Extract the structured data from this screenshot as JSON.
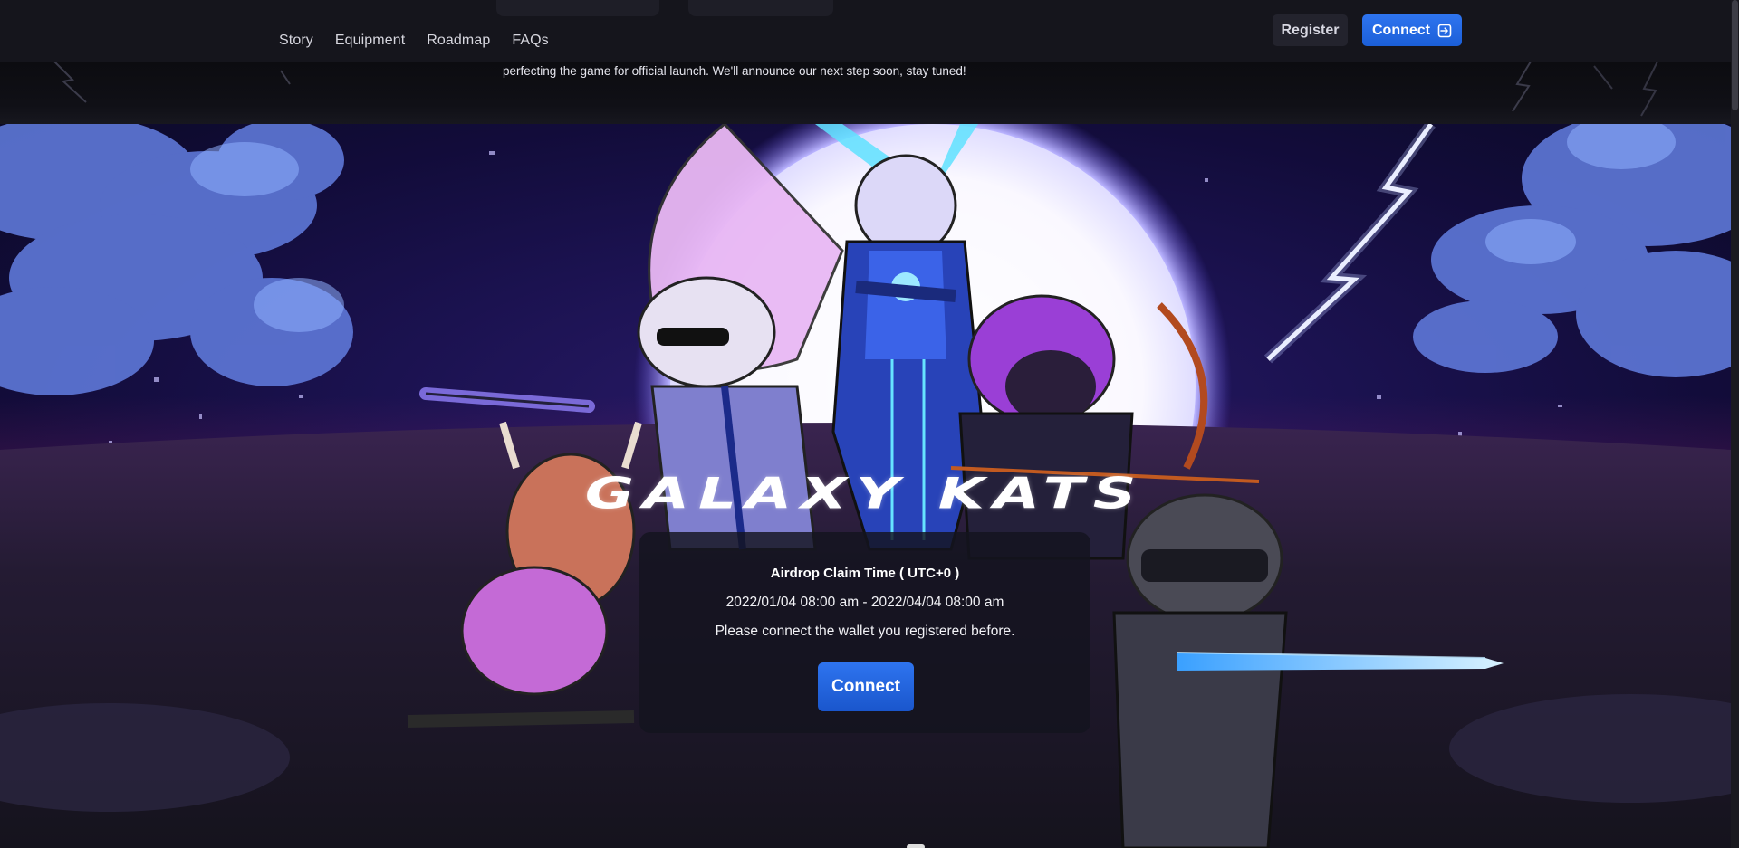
{
  "nav": {
    "links": [
      "Story",
      "Equipment",
      "Roadmap",
      "FAQs"
    ],
    "register_label": "Register",
    "connect_label": "Connect",
    "connect_icon": "login-arrow-icon"
  },
  "announcement": {
    "text": "perfecting the game for official launch. We'll announce our next step soon, stay tuned!"
  },
  "hero": {
    "logo_text": "GALAXY KATS"
  },
  "claim": {
    "title": "Airdrop Claim Time ( UTC+0 )",
    "range": "2022/01/04 08:00 am - 2022/04/04 08:00 am",
    "hint": "Please connect the wallet you registered before.",
    "button_label": "Connect"
  },
  "colors": {
    "accent_blue": "#1f66e0",
    "nav_bg": "#15151c",
    "sky_deep": "#120c3a",
    "moon_glow": "#ffffff"
  }
}
